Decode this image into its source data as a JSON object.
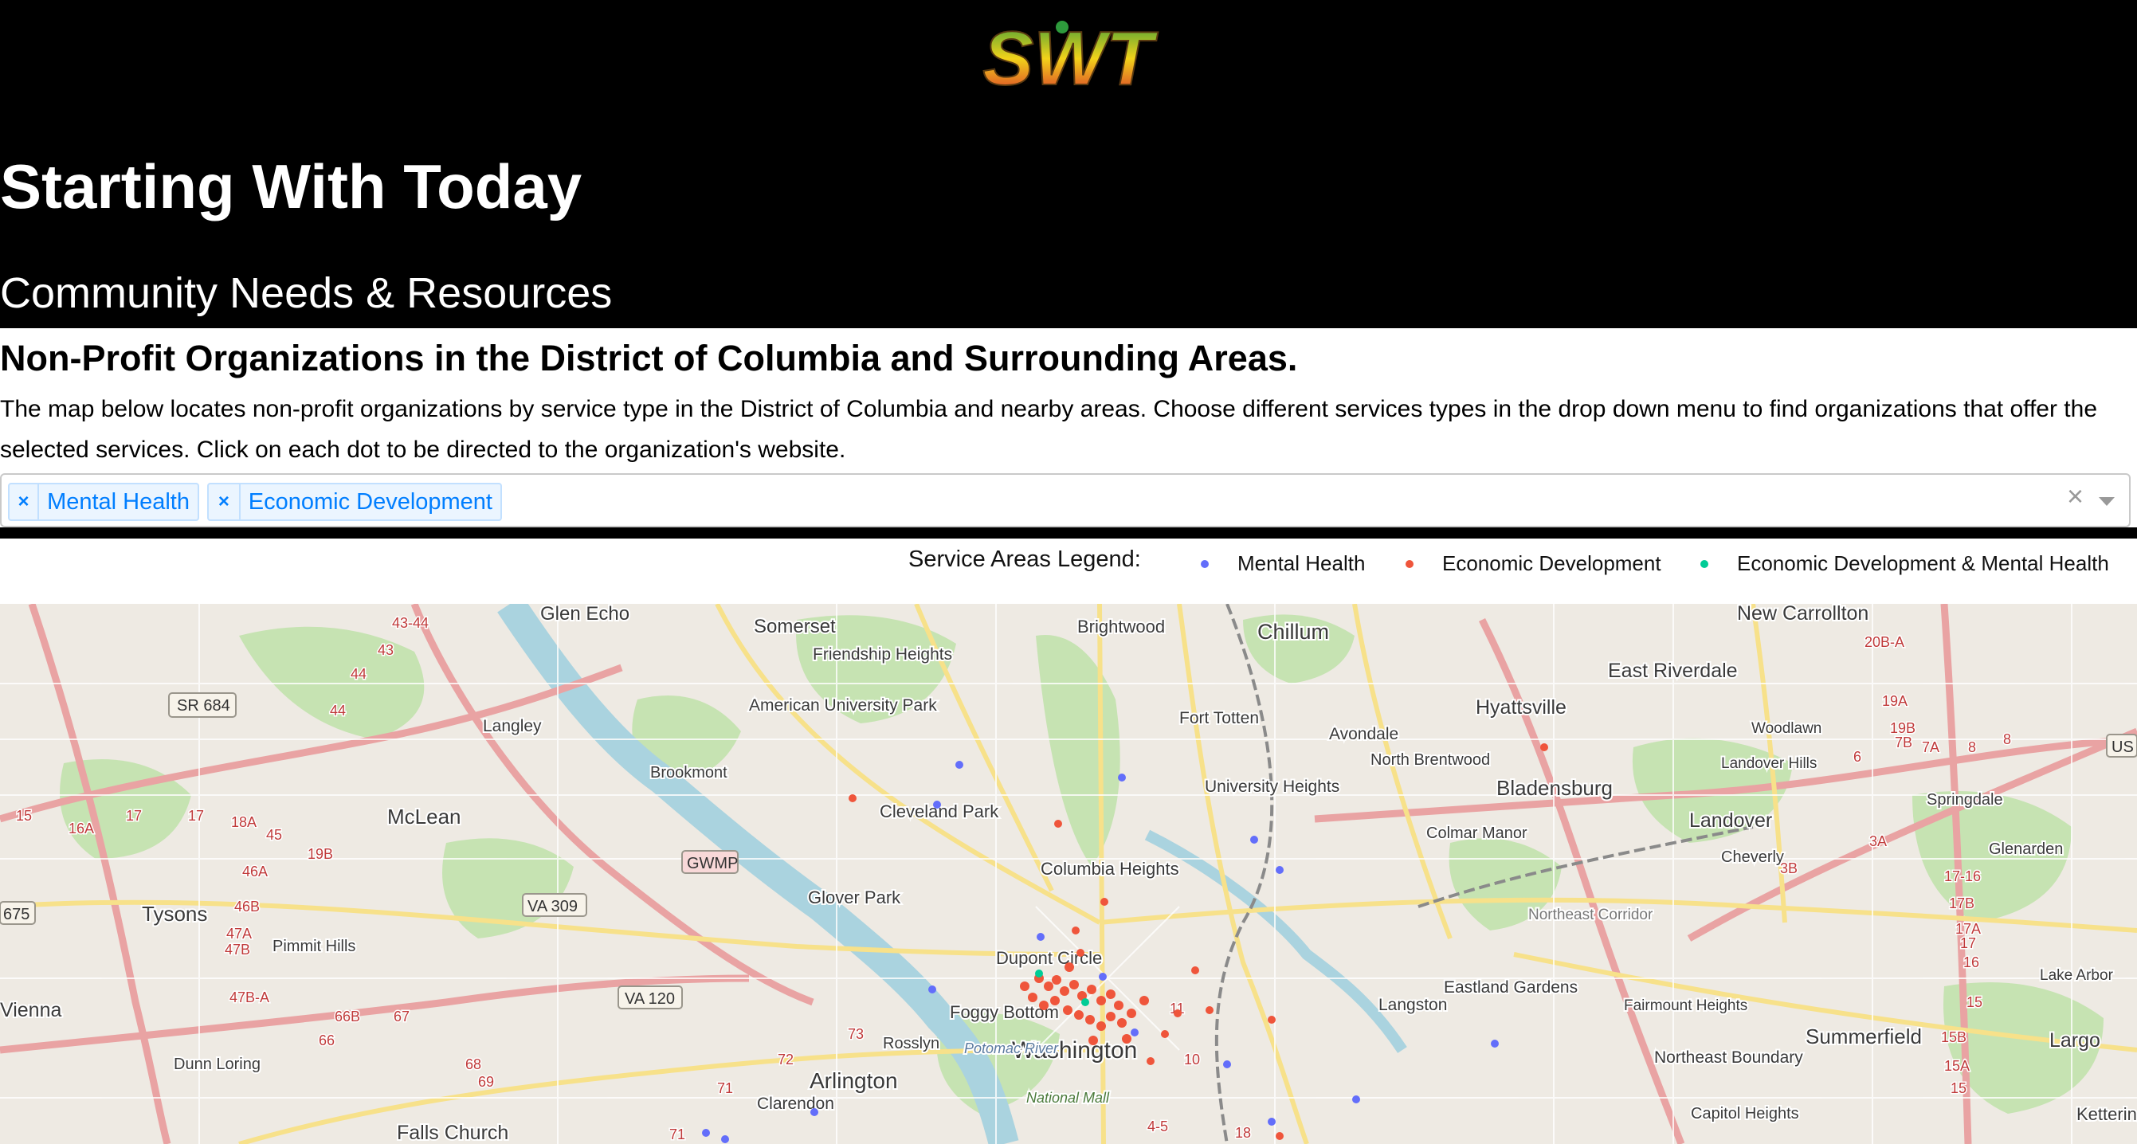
{
  "header": {
    "logo_text": "SWT",
    "title": "Starting With Today",
    "subtitle": "Community Needs & Resources"
  },
  "main": {
    "heading": "Non-Profit Organizations in the District of Columbia and Surrounding Areas.",
    "description": "The map below locates non-profit organizations by service type in the District of Columbia and nearby areas. Choose different services types in the drop down menu to find organizations that offer the selected services. Click on each dot to be directed to the organization's website."
  },
  "filter": {
    "selected": [
      "Mental Health",
      "Economic Development"
    ],
    "remove_glyph": "×",
    "clear_glyph": "×"
  },
  "legend": {
    "title": "Service Areas Legend:",
    "items": [
      {
        "label": "Mental Health",
        "color": "#636efa"
      },
      {
        "label": "Economic Development",
        "color": "#ef553b"
      },
      {
        "label": "Economic Development & Mental Health",
        "color": "#00cc96"
      }
    ]
  },
  "map": {
    "places": [
      "Glen Echo",
      "Somerset",
      "Brightwood",
      "Chillum",
      "New Carrollton",
      "Friendship Heights",
      "American University Park",
      "Fort Totten",
      "Avondale",
      "Hyattsville",
      "East Riverdale",
      "Langley",
      "Brookmont",
      "University Heights",
      "North Brentwood",
      "Bladensburg",
      "Woodlawn",
      "Landover Hills",
      "Springdale",
      "McLean",
      "Cleveland Park",
      "Colmar Manor",
      "Landover",
      "Cheverly",
      "Glenarden",
      "Columbia Heights",
      "Tysons",
      "Glover Park",
      "Pimmit Hills",
      "Northeast Corridor",
      "Dupont Circle",
      "Eastland Gardens",
      "Langston",
      "Fairmount Heights",
      "Lake Arbor",
      "Foggy Bottom",
      "Washington",
      "Rosslyn",
      "Potomac River",
      "Summerfield",
      "Largo",
      "Northeast Boundary",
      "Dunn Loring",
      "Arlington",
      "National Mall",
      "Clarendon",
      "Falls Church",
      "Capitol Heights",
      "Kettering",
      "Vienna"
    ],
    "shields": [
      "SR 684",
      "GWMP",
      "VA 309",
      "VA 120",
      "675",
      "US"
    ]
  }
}
